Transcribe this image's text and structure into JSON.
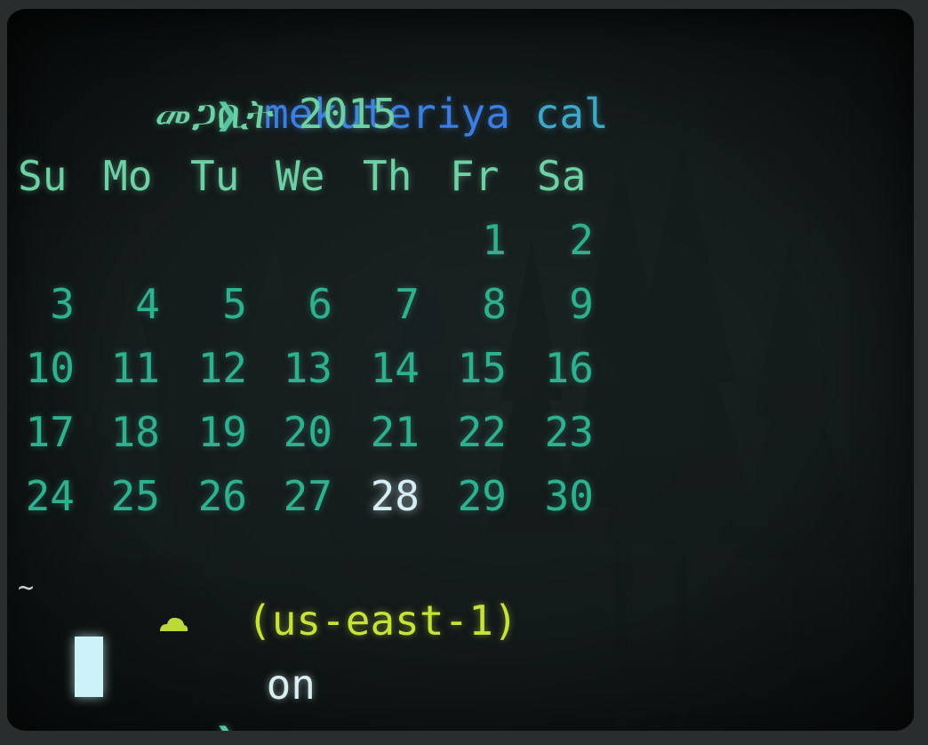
{
  "terminal": {
    "command_prompt": "❯",
    "command_name": "mekuteriya",
    "command_arg": "cal",
    "calendar": {
      "month_year": "መጋቢት 2015",
      "weekdays": [
        "Su",
        "Mo",
        "Tu",
        "We",
        "Th",
        "Fr",
        "Sa"
      ],
      "weeks": [
        [
          "",
          "",
          "",
          "",
          "",
          "1",
          "2"
        ],
        [
          "3",
          "4",
          "5",
          "6",
          "7",
          "8",
          "9"
        ],
        [
          "10",
          "11",
          "12",
          "13",
          "14",
          "15",
          "16"
        ],
        [
          "17",
          "18",
          "19",
          "20",
          "21",
          "22",
          "23"
        ],
        [
          "24",
          "25",
          "26",
          "27",
          "28",
          "29",
          "30"
        ]
      ],
      "today": "28"
    },
    "status": {
      "cwd": "~",
      "on_text": "on",
      "cloud_icon": "cloud-icon",
      "region": "(us-east-1)"
    },
    "input_prompt": "❯"
  },
  "colors": {
    "command_blue": "#3c7fe0",
    "arg_cyan": "#3fa8c7",
    "calendar_teal": "#2fb08f",
    "region_lime": "#c7e33a",
    "cursor": "#cdf3f8"
  }
}
